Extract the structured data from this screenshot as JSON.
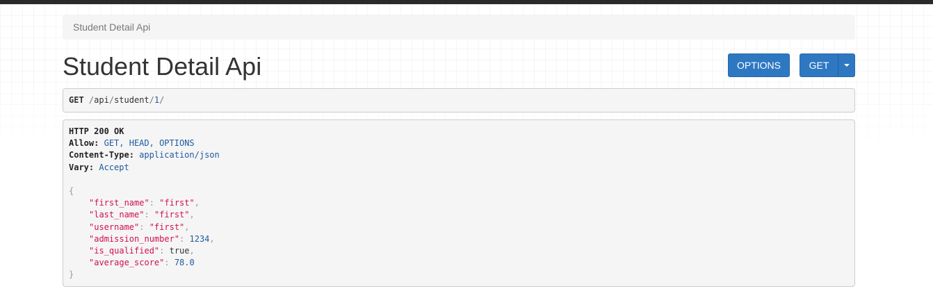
{
  "breadcrumb": {
    "item": "Student Detail Api"
  },
  "page": {
    "title": "Student Detail Api"
  },
  "buttons": {
    "options_label": "OPTIONS",
    "get_label": "GET"
  },
  "request": {
    "method": "GET",
    "path_segments": [
      "api",
      "student",
      "1"
    ]
  },
  "response": {
    "status_line": "HTTP 200 OK",
    "headers": [
      {
        "name": "Allow:",
        "value": "GET, HEAD, OPTIONS"
      },
      {
        "name": "Content-Type:",
        "value": "application/json"
      },
      {
        "name": "Vary:",
        "value": "Accept"
      }
    ],
    "body": {
      "open_brace": "{",
      "close_brace": "}",
      "fields": [
        {
          "key": "\"first_name\"",
          "value": "\"first\"",
          "type": "string"
        },
        {
          "key": "\"last_name\"",
          "value": "\"first\"",
          "type": "string"
        },
        {
          "key": "\"username\"",
          "value": "\"first\"",
          "type": "string"
        },
        {
          "key": "\"admission_number\"",
          "value": "1234",
          "type": "number"
        },
        {
          "key": "\"is_qualified\"",
          "value": "true",
          "type": "literal"
        },
        {
          "key": "\"average_score\"",
          "value": "78.0",
          "type": "number"
        }
      ]
    }
  },
  "colors": {
    "button": "#2e78c2",
    "json_key": "#d0104c",
    "json_number": "#1e5aa0",
    "header_value": "#1e5aa0"
  }
}
